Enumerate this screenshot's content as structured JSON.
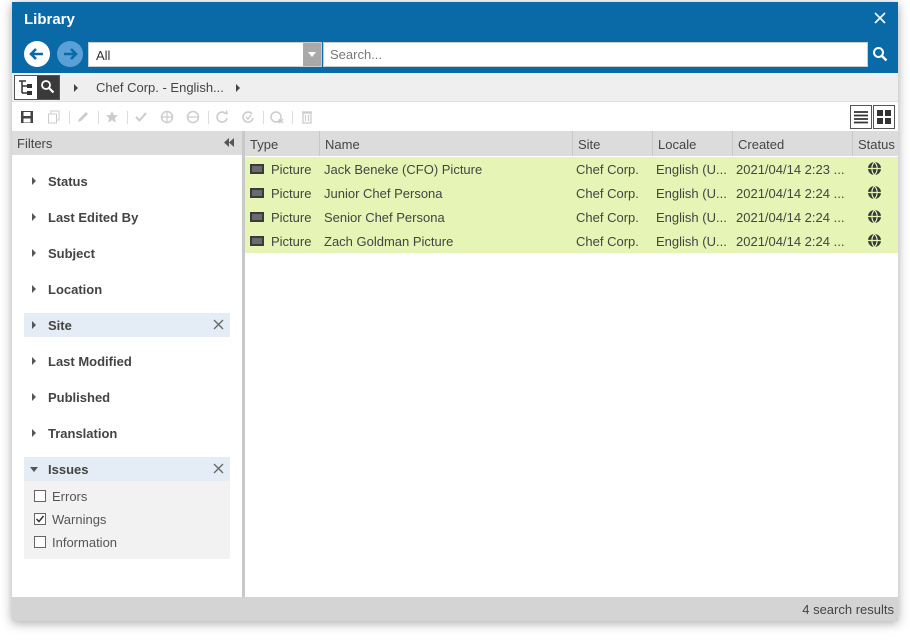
{
  "window": {
    "title": "Library"
  },
  "nav": {
    "scope_value": "All",
    "search_placeholder": "Search..."
  },
  "breadcrumb": {
    "item": "Chef Corp. - English..."
  },
  "filters": {
    "header": "Filters",
    "items": [
      {
        "label": "Status"
      },
      {
        "label": "Last Edited By"
      },
      {
        "label": "Subject"
      },
      {
        "label": "Location"
      },
      {
        "label": "Site"
      },
      {
        "label": "Last Modified"
      },
      {
        "label": "Published"
      },
      {
        "label": "Translation"
      },
      {
        "label": "Issues"
      }
    ],
    "issues_options": [
      {
        "label": "Errors",
        "checked": false
      },
      {
        "label": "Warnings",
        "checked": true
      },
      {
        "label": "Information",
        "checked": false
      }
    ]
  },
  "grid": {
    "columns": [
      "Type",
      "Name",
      "Site",
      "Locale",
      "Created",
      "Status"
    ],
    "rows": [
      {
        "type": "Picture",
        "name": "Jack Beneke (CFO) Picture",
        "site": "Chef Corp.",
        "locale": "English (U...",
        "created": "2021/04/14 2:23 ..."
      },
      {
        "type": "Picture",
        "name": "Junior Chef Persona",
        "site": "Chef Corp.",
        "locale": "English (U...",
        "created": "2021/04/14 2:24 ..."
      },
      {
        "type": "Picture",
        "name": "Senior Chef Persona",
        "site": "Chef Corp.",
        "locale": "English (U...",
        "created": "2021/04/14 2:24 ..."
      },
      {
        "type": "Picture",
        "name": "Zach Goldman Picture",
        "site": "Chef Corp.",
        "locale": "English (U...",
        "created": "2021/04/14 2:24 ..."
      }
    ]
  },
  "footer": {
    "result_count": "4 search results"
  },
  "colors": {
    "titlebar": "#0a6aa8",
    "row_highlight": "#e6f5b5",
    "filter_active": "#e4edf5"
  }
}
